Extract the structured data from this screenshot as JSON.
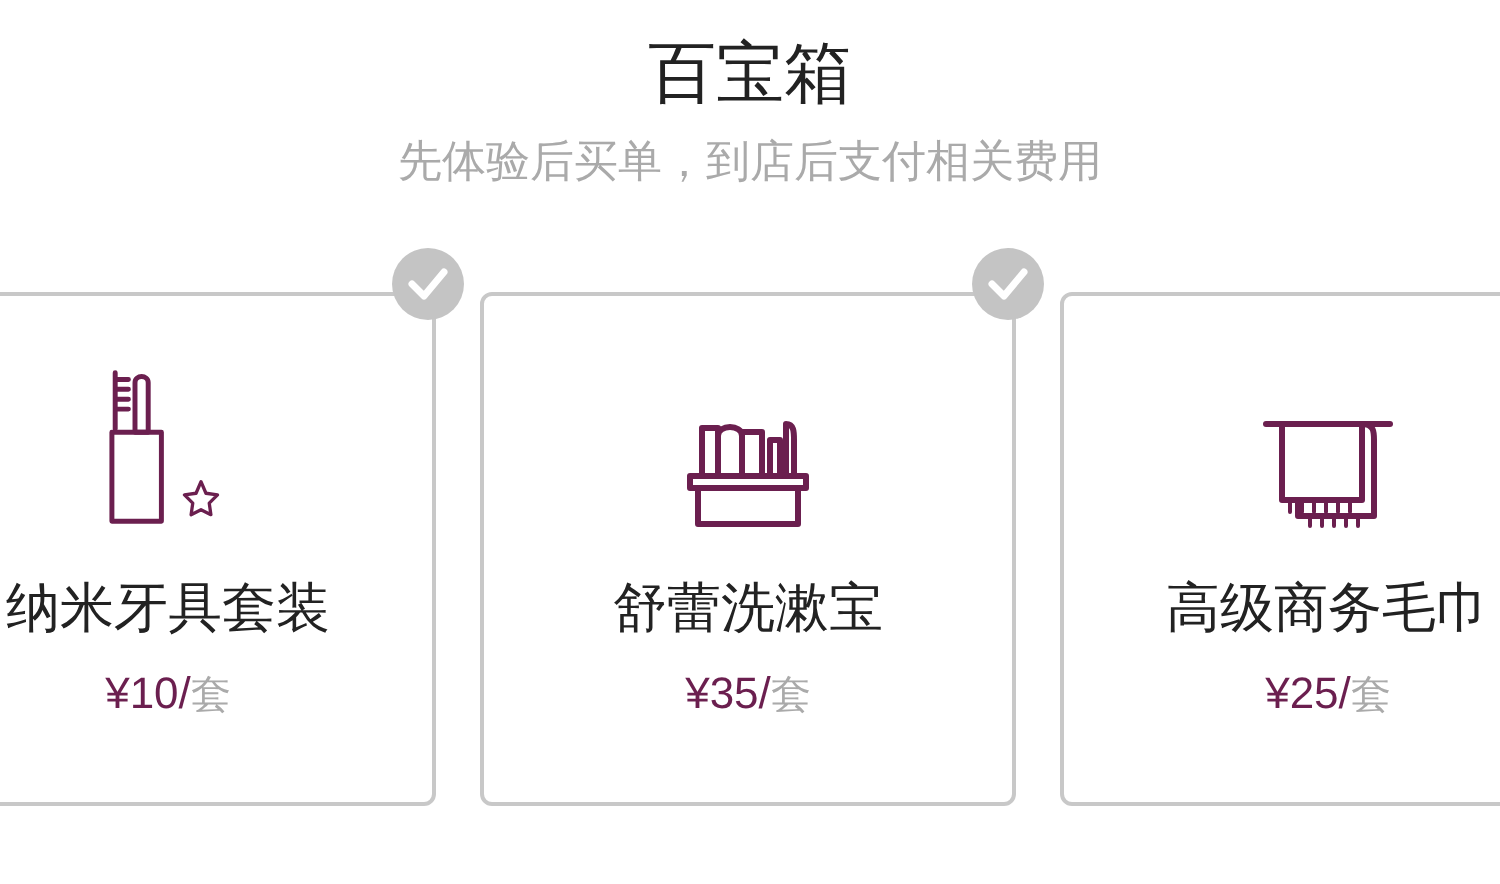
{
  "title": "百宝箱",
  "subtitle": "先体验后买单，到店后支付相关费用",
  "items": [
    {
      "kind": "toothbrush",
      "name": "纳米牙具套装",
      "price": "¥10/",
      "unit": "套",
      "selected": true
    },
    {
      "kind": "toiletries",
      "name": "舒蕾洗漱宝",
      "price": "¥35/",
      "unit": "套",
      "selected": true
    },
    {
      "kind": "towel",
      "name": "高级商务毛巾",
      "price": "¥25/",
      "unit": "套",
      "selected": false
    }
  ]
}
